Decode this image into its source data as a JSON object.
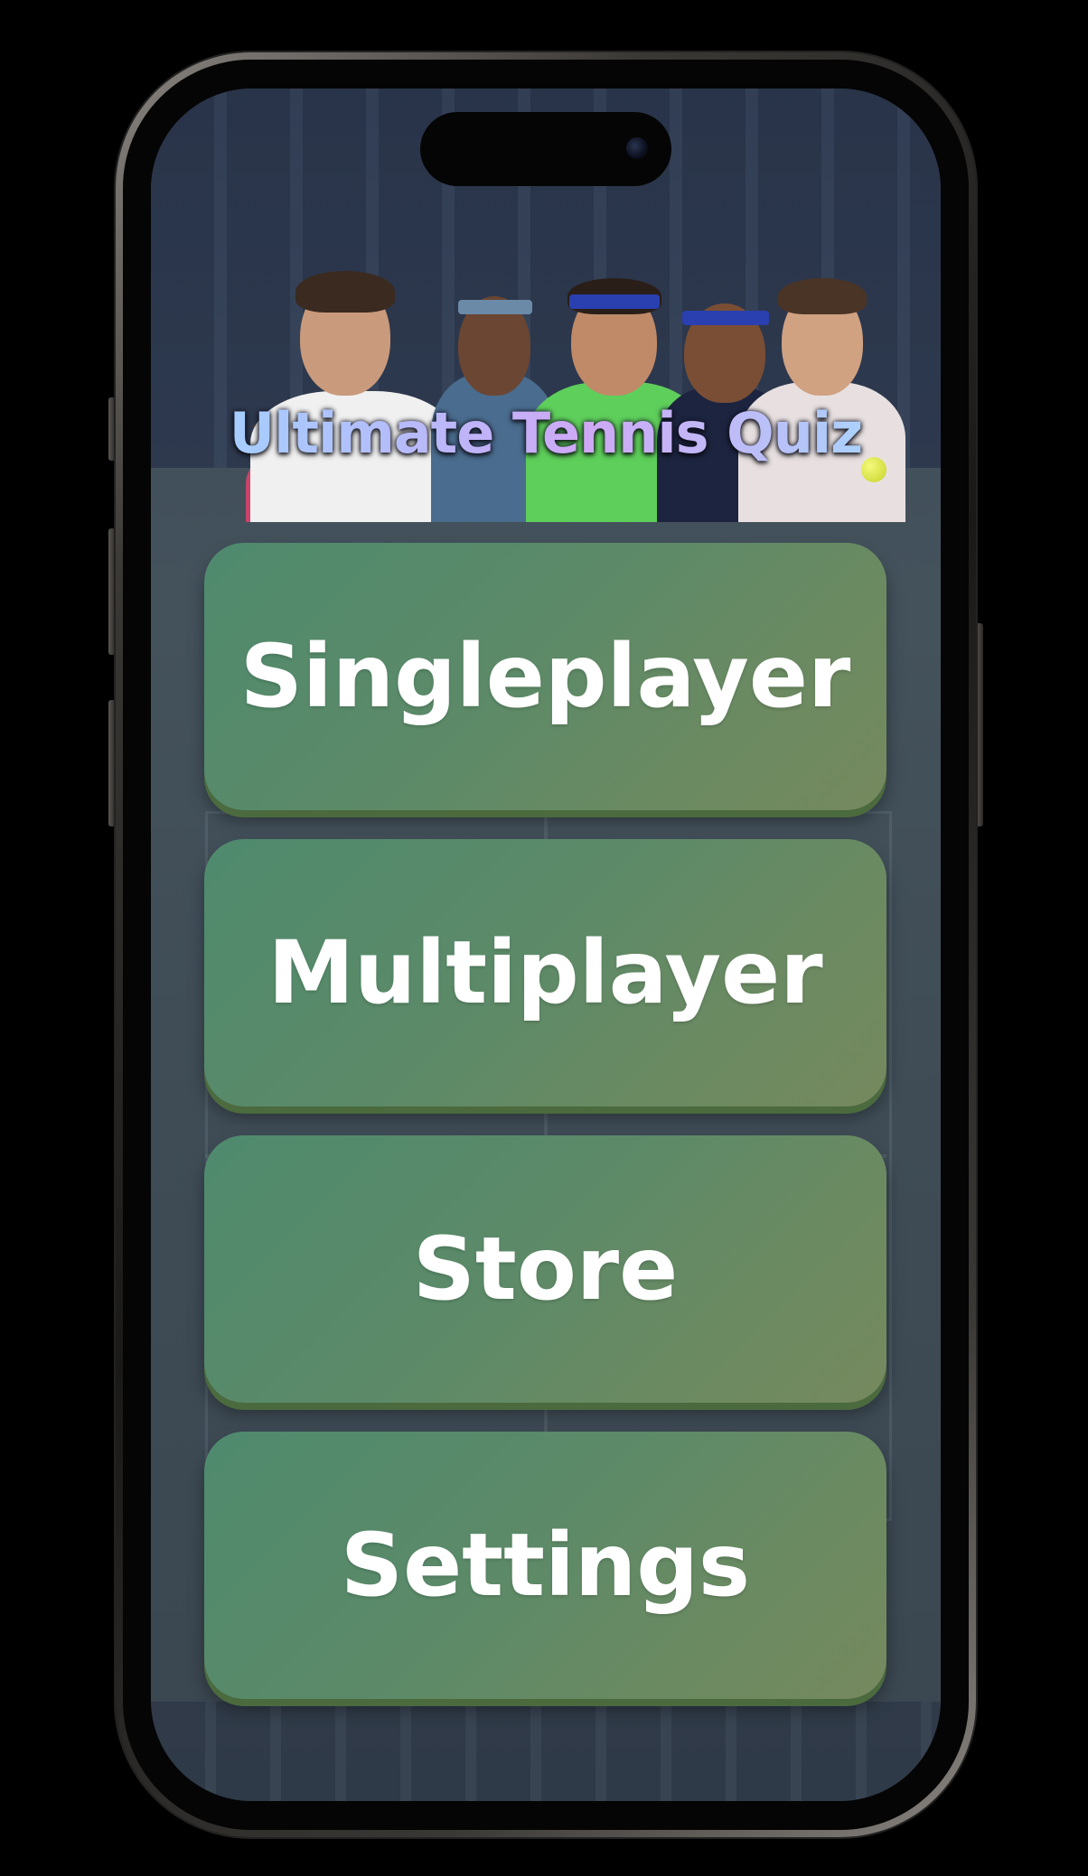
{
  "app": {
    "title": "Ultimate Tennis Quiz"
  },
  "menu": {
    "items": [
      {
        "label": "Singleplayer"
      },
      {
        "label": "Multiplayer"
      },
      {
        "label": "Store"
      },
      {
        "label": "Settings"
      }
    ]
  },
  "colors": {
    "button_gradient_start": "#4f8a6e",
    "button_gradient_end": "#76895e",
    "button_shadow": "#4b6a3e",
    "background": "#3f4c56",
    "title_gradient": [
      "#9fd6ff",
      "#cfa8f5",
      "#9fe0ff"
    ]
  },
  "icons": {
    "banner": "tennis-players-banner"
  }
}
